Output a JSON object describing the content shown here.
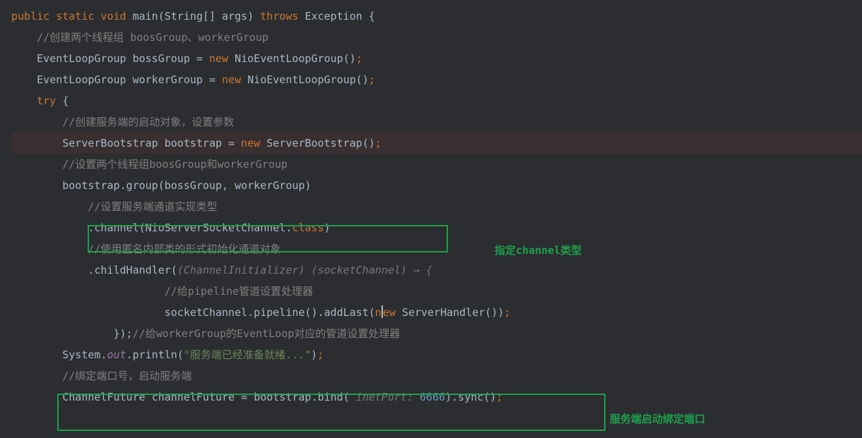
{
  "code": {
    "l1": {
      "public": "public",
      "static": "static",
      "void": "void",
      "main": "main",
      "sig": "(String[] args)",
      "throws": "throws",
      "exc": "Exception",
      "brace": " {"
    },
    "l2": {
      "comment": "//创建两个线程组 boosGroup、workerGroup"
    },
    "l3": {
      "type": "EventLoopGroup",
      "var": "bossGroup",
      "eq": " = ",
      "new": "new",
      "ctor": "NioEventLoopGroup()",
      "semi": ";"
    },
    "l4": {
      "type": "EventLoopGroup",
      "var": "workerGroup",
      "eq": " = ",
      "new": "new",
      "ctor": "NioEventLoopGroup()",
      "semi": ";"
    },
    "l5": {
      "try": "try",
      "brace": " {"
    },
    "l6": {
      "comment": "//创建服务端的启动对象，设置参数"
    },
    "l7": {
      "type": "ServerBootstrap",
      "var": "bootstrap",
      "eq": " = ",
      "new": "new",
      "ctor": "ServerBootstrap()",
      "semi": ";"
    },
    "l8": {
      "comment": "//设置两个线程组boosGroup和workerGroup"
    },
    "l9": {
      "obj": "bootstrap",
      "method": ".group(bossGroup, workerGroup)"
    },
    "l10": {
      "comment": "//设置服务端通道实现类型"
    },
    "l11": {
      "method": ".channel(NioServerSocketChannel.",
      "class": "class",
      "close": ")"
    },
    "l12": {
      "comment": "//使用匿名内部类的形式初始化通道对象"
    },
    "l13": {
      "method": ".childHandler(",
      "cast": "(ChannelInitializer) (socketChannel) → {"
    },
    "l14": {
      "comment": "//给pipeline管道设置处理器"
    },
    "l15": {
      "call": "socketChannel.pipeline().addLast(",
      "new": "new",
      "ctor": " ServerHandler())",
      "semi": ";"
    },
    "l16": {
      "close": "});",
      "comment": "//给workerGroup的EventLoop对应的管道设置处理器"
    },
    "l17": {
      "sys": "System.",
      "out": "out",
      "print": ".println(",
      "str": "\"服务端已经准备就绪...\"",
      "close": ")",
      "semi": ";"
    },
    "l18": {
      "comment": "//绑定端口号，启动服务端"
    },
    "l19": {
      "type": "ChannelFuture",
      "var": "channelFuture",
      "eq": " = ",
      "obj": "bootstrap.bind( ",
      "hint": "inetPort: ",
      "num": "6666",
      "close": ").sync()",
      "semi": ";"
    }
  },
  "annotations": {
    "a1": "指定channel类型",
    "a2": "服务端启动绑定端口"
  }
}
